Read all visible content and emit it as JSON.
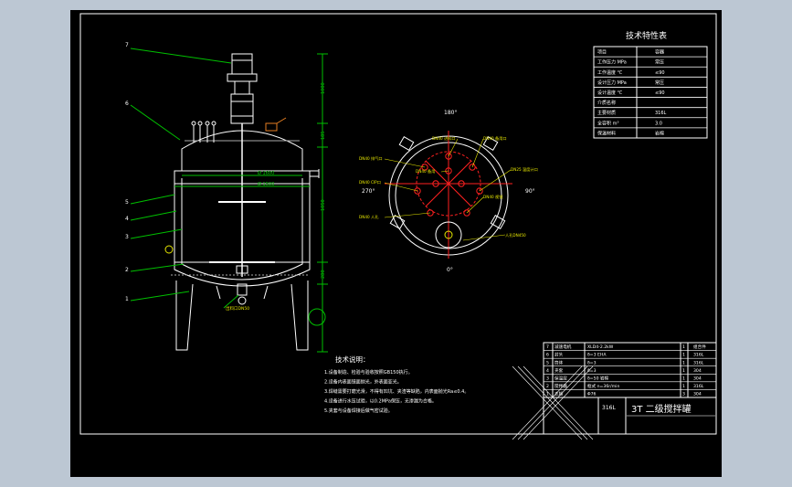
{
  "colors": {
    "background": "#bcc7d3",
    "sheet": "#000000",
    "line": "#ffffff",
    "dim": "#00c000",
    "leader": "#00c000",
    "red": "#ff2020",
    "yellow": "#e6e600"
  },
  "spec_table": {
    "title": "技术特性表",
    "header": [
      "项目",
      "容器"
    ],
    "rows": [
      [
        "工作压力 MPa",
        "常压"
      ],
      [
        "工作温度 ℃",
        "≤90"
      ],
      [
        "设计压力 MPa",
        "常压"
      ],
      [
        "设计温度 ℃",
        "≤90"
      ],
      [
        "介质名称",
        ""
      ],
      [
        "主要材质",
        "316L"
      ],
      [
        "全容积 m³",
        "3.0"
      ],
      [
        "保温材料",
        "岩棉"
      ]
    ]
  },
  "front_view": {
    "callouts": [
      "7",
      "6",
      "5",
      "4",
      "3",
      "2",
      "1"
    ],
    "dims": {
      "left": [
        "1000",
        "185",
        "1050",
        "280"
      ],
      "diameters": [
        "Ø 1600",
        "Ø 1500"
      ]
    },
    "bottom_label": "出料口DN50"
  },
  "top_view": {
    "angle_top": "180°",
    "angle_left": "270°",
    "angle_right": "90°",
    "angle_bottom": "0°",
    "nozzle_labels": [
      "DN40 进料口",
      "DN40 备用口",
      "DN40 排气口",
      "DN25 温度计口",
      "DN40 CIP口",
      "DN40 视镜",
      "DN40 人孔",
      "DN40 备用"
    ],
    "manhole_label": "人孔DN450"
  },
  "notes": {
    "title": "技术说明：",
    "lines": [
      "1.设备制造、检验与验收按照GB150执行。",
      "2.设备内表面镜面抛光，外表面亚光。",
      "3.焊缝需要打磨光滑，不得有凹坑、夹渣等缺陷，内表面抛光Ra≤0.4。",
      "4.设备进行水压试验，以0.2MPa保压，无渗漏为合格。",
      "5.夹套与设备焊接后做气密试验。"
    ]
  },
  "bom": {
    "rows": [
      [
        "7",
        "减速电机",
        "XLD4-2.2kW",
        "1",
        "组合件"
      ],
      [
        "6",
        "封头",
        "δ=3 EHA",
        "1",
        "316L"
      ],
      [
        "5",
        "筒体",
        "δ=3",
        "1",
        "316L"
      ],
      [
        "4",
        "夹套",
        "δ=3",
        "1",
        "304"
      ],
      [
        "3",
        "保温层",
        "δ=50 岩棉",
        "1",
        "304"
      ],
      [
        "2",
        "搅拌器",
        "框式 n=36r/min",
        "1",
        "316L"
      ],
      [
        "1",
        "支腿",
        "Φ76",
        "3",
        "304"
      ]
    ]
  },
  "title_block": {
    "material": "316L",
    "drawing_title": "3T 二级搅拌罐"
  }
}
